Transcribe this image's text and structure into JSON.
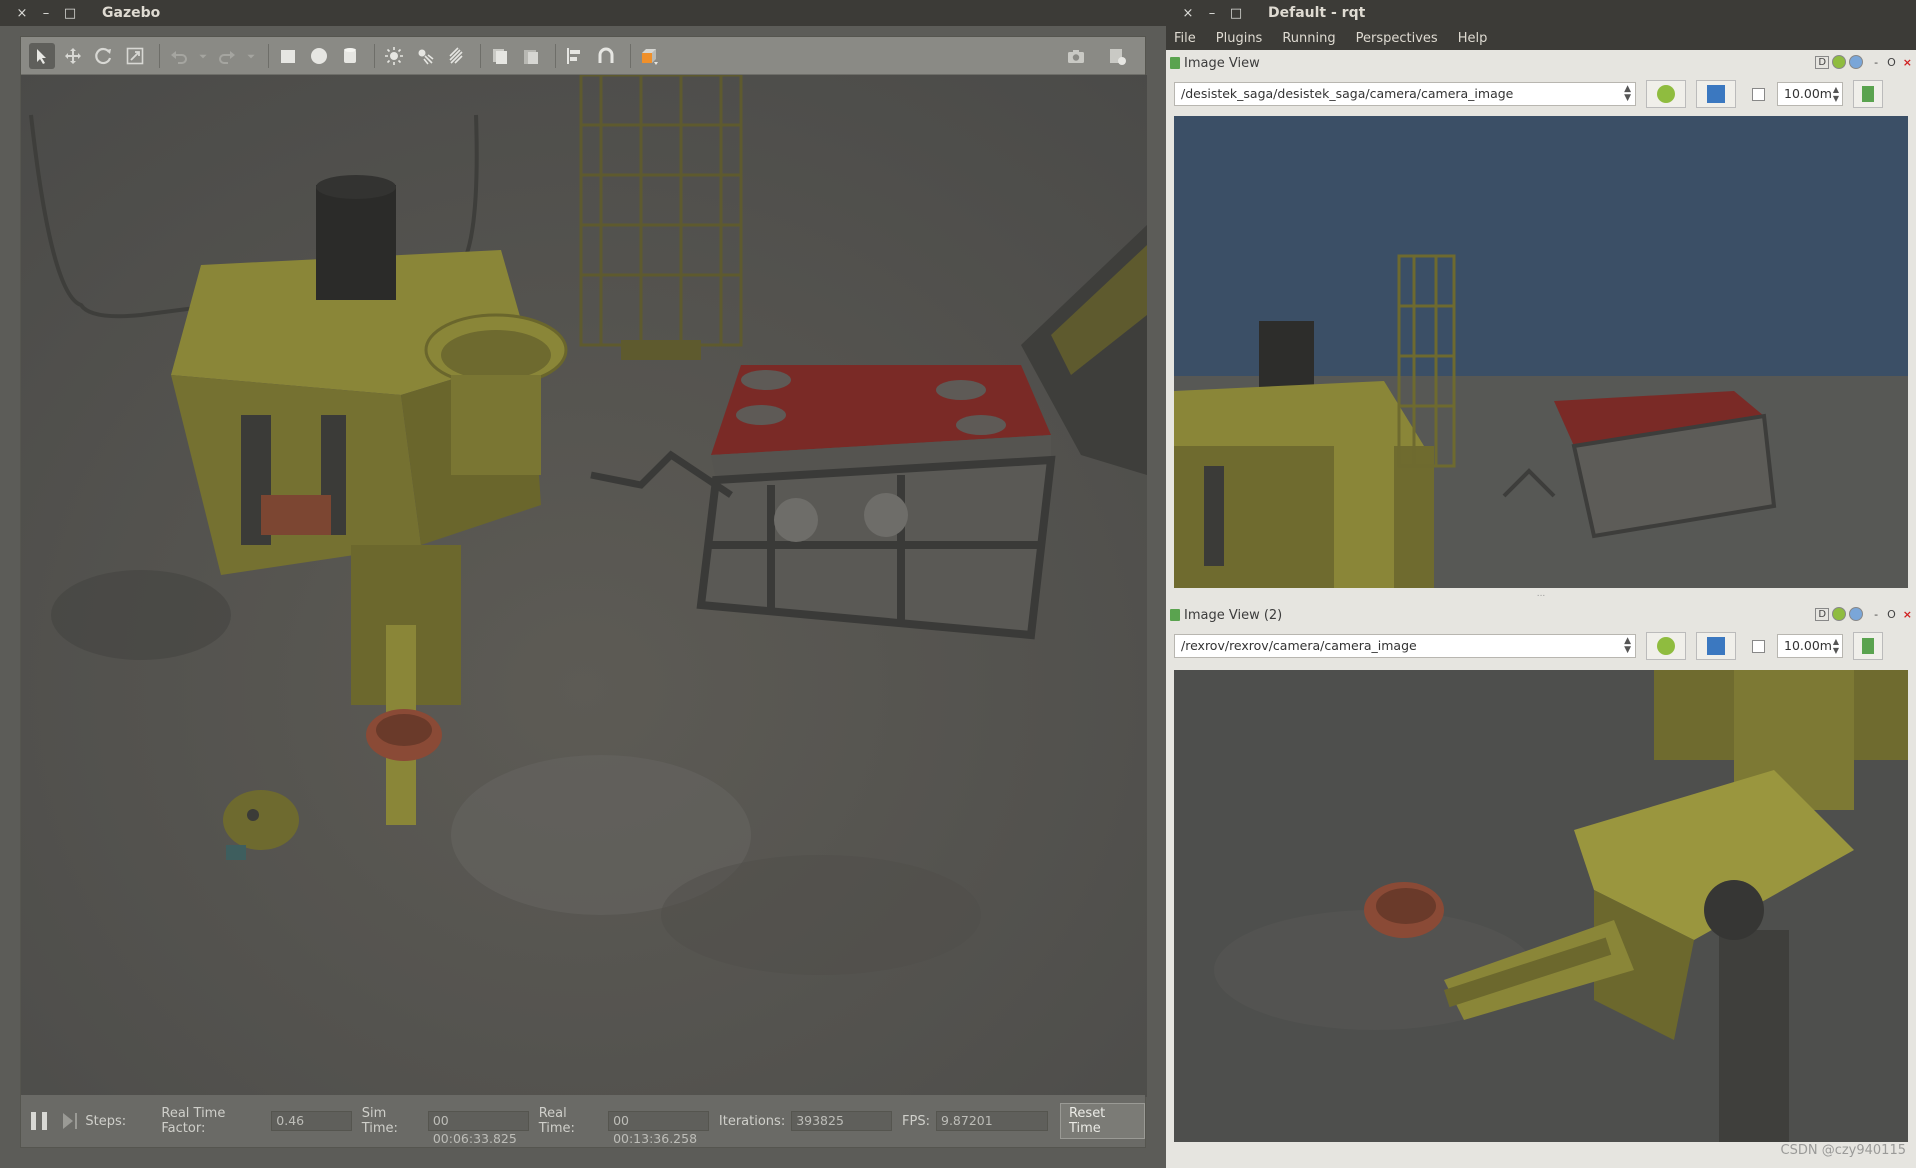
{
  "gazebo": {
    "title": "Gazebo",
    "window_controls": {
      "close": "×",
      "minimize": "–",
      "maximize": "□"
    },
    "toolbar": {
      "tools": [
        "select-icon",
        "translate-icon",
        "rotate-icon",
        "scale-icon",
        "undo-icon",
        "undo-dropdown-icon",
        "redo-icon",
        "redo-dropdown-icon",
        "box-icon",
        "sphere-icon",
        "cylinder-icon",
        "point-light-icon",
        "spot-light-icon",
        "directional-light-icon",
        "copy-icon",
        "paste-icon",
        "align-icon",
        "snap-icon",
        "view-angle-icon"
      ],
      "right_tools": [
        "screenshot-icon",
        "record-icon"
      ]
    },
    "status": {
      "steps_label": "Steps:",
      "rtf_label": "Real Time Factor:",
      "rtf_value": "0.46",
      "sim_time_label": "Sim Time:",
      "sim_time_value": "00 00:06:33.825",
      "real_time_label": "Real Time:",
      "real_time_value": "00 00:13:36.258",
      "iterations_label": "Iterations:",
      "iterations_value": "393825",
      "fps_label": "FPS:",
      "fps_value": "9.87201",
      "reset_label": "Reset Time"
    }
  },
  "rqt": {
    "title": "Default - rqt",
    "window_controls": {
      "close": "×",
      "minimize": "–",
      "maximize": "□"
    },
    "menu": [
      "File",
      "Plugins",
      "Running",
      "Perspectives",
      "Help"
    ],
    "views": [
      {
        "label": "Image View",
        "topic": "/desistek_saga/desistek_saga/camera/camera_image",
        "spin_value": "10.00m",
        "ctrl_d": "D",
        "ctrl_min": "-",
        "ctrl_restore": "O",
        "ctrl_close": "×"
      },
      {
        "label": "Image View (2)",
        "topic": "/rexrov/rexrov/camera/camera_image",
        "spin_value": "10.00m",
        "ctrl_d": "D",
        "ctrl_min": "-",
        "ctrl_restore": "O",
        "ctrl_close": "×"
      }
    ],
    "splitter": "...",
    "watermark": "CSDN @czy940115"
  }
}
